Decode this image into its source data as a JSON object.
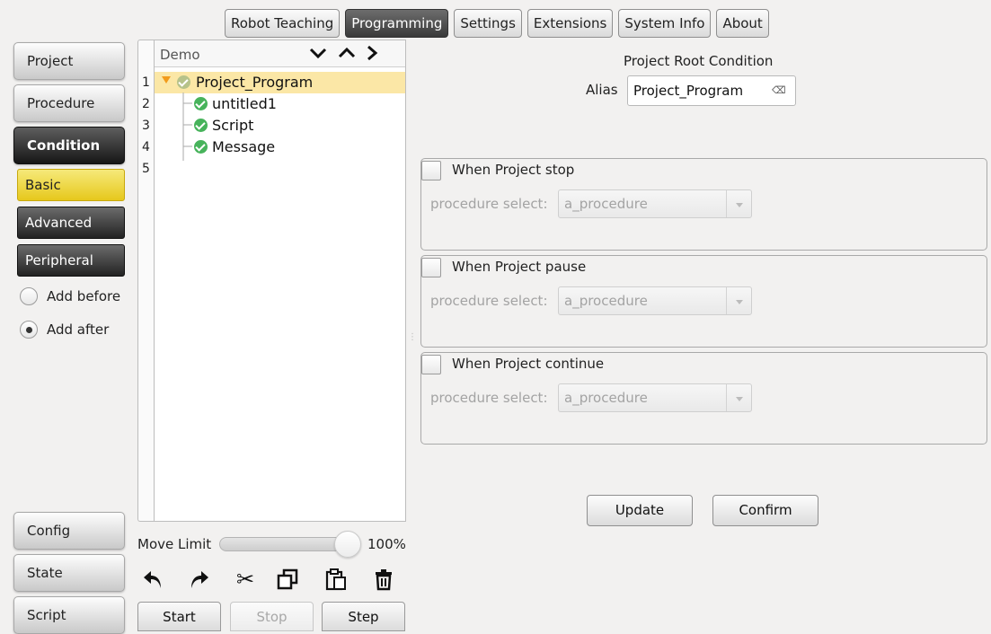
{
  "top_tabs": [
    "Robot Teaching",
    "Programming",
    "Settings",
    "Extensions",
    "System Info",
    "About"
  ],
  "active_top_tab": "Programming",
  "left_nav": {
    "project": "Project",
    "procedure": "Procedure",
    "condition": "Condition",
    "basic": "Basic",
    "advanced": "Advanced",
    "peripheral": "Peripheral",
    "add_before": "Add before",
    "add_after": "Add after",
    "selected_insert": "Add after",
    "config": "Config",
    "state": "State",
    "script": "Script"
  },
  "tree": {
    "title": "Demo",
    "line_numbers": [
      "1",
      "2",
      "3",
      "4",
      "5"
    ],
    "items": [
      {
        "label": "Project_Program",
        "selected": true
      },
      {
        "label": "untitled1"
      },
      {
        "label": "Script"
      },
      {
        "label": "Message"
      }
    ]
  },
  "move_limit": {
    "label": "Move Limit",
    "value_text": "100%",
    "value": 1.0
  },
  "toolbar_icons": [
    "undo-icon",
    "redo-icon",
    "cut-icon",
    "copy-icon",
    "paste-icon",
    "delete-icon"
  ],
  "run_buttons": {
    "start": "Start",
    "stop": "Stop",
    "step": "Step"
  },
  "panel": {
    "title": "Project Root Condition",
    "alias_label": "Alias",
    "alias_value": "Project_Program",
    "clear_glyph": "⌫",
    "groups": [
      {
        "title": "When Project stop",
        "procedure_label": "procedure select:",
        "procedure_value": "a_procedure"
      },
      {
        "title": "When Project pause",
        "procedure_label": "procedure select:",
        "procedure_value": "a_procedure"
      },
      {
        "title": "When Project continue",
        "procedure_label": "procedure select:",
        "procedure_value": "a_procedure"
      }
    ],
    "update_label": "Update",
    "confirm_label": "Confirm"
  },
  "colors": {
    "selected_row": "#fbe7a6",
    "basic_button": "#f0d94a",
    "status_ok": "#47b35b",
    "active_tab": "#4a4a4a"
  }
}
